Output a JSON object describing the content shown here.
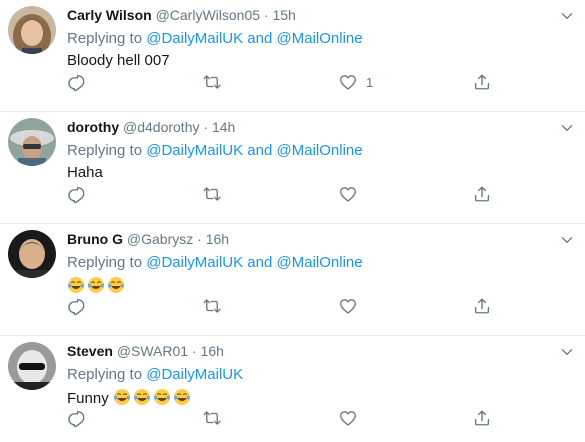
{
  "tweets": [
    {
      "name": "Carly Wilson",
      "handle": "@CarlyWilson05",
      "dot": "·",
      "time": "15h",
      "replying_prefix": "Replying to ",
      "mention1": "@DailyMailUK",
      "and_text": " and ",
      "mention2": "@MailOnline",
      "text": "Bloody hell 007",
      "like_count": "1"
    },
    {
      "name": "dorothy",
      "handle": "@d4dorothy",
      "dot": "·",
      "time": "14h",
      "replying_prefix": "Replying to ",
      "mention1": "@DailyMailUK",
      "and_text": " and ",
      "mention2": "@MailOnline",
      "text": "Haha"
    },
    {
      "name": "Bruno G",
      "handle": "@Gabrysz",
      "dot": "·",
      "time": "16h",
      "replying_prefix": "Replying to ",
      "mention1": "@DailyMailUK",
      "and_text": " and ",
      "mention2": "@MailOnline",
      "emoji_count": 3
    },
    {
      "name": "Steven",
      "handle": "@SWAR01",
      "dot": "·",
      "time": "16h",
      "replying_prefix": "Replying to ",
      "mention1": "@DailyMailUK",
      "text": "Funny ",
      "emoji_count": 4
    }
  ],
  "icons": {
    "reply": "reply-icon",
    "retweet": "retweet-icon",
    "like": "heart-icon",
    "share": "share-icon",
    "caret": "chevron-down-icon",
    "emoji": "face-with-tears-of-joy-icon"
  },
  "colors": {
    "link": "#1b95e0",
    "secondary": "#657786",
    "text": "#14171a",
    "divider": "#e6ecf0"
  }
}
